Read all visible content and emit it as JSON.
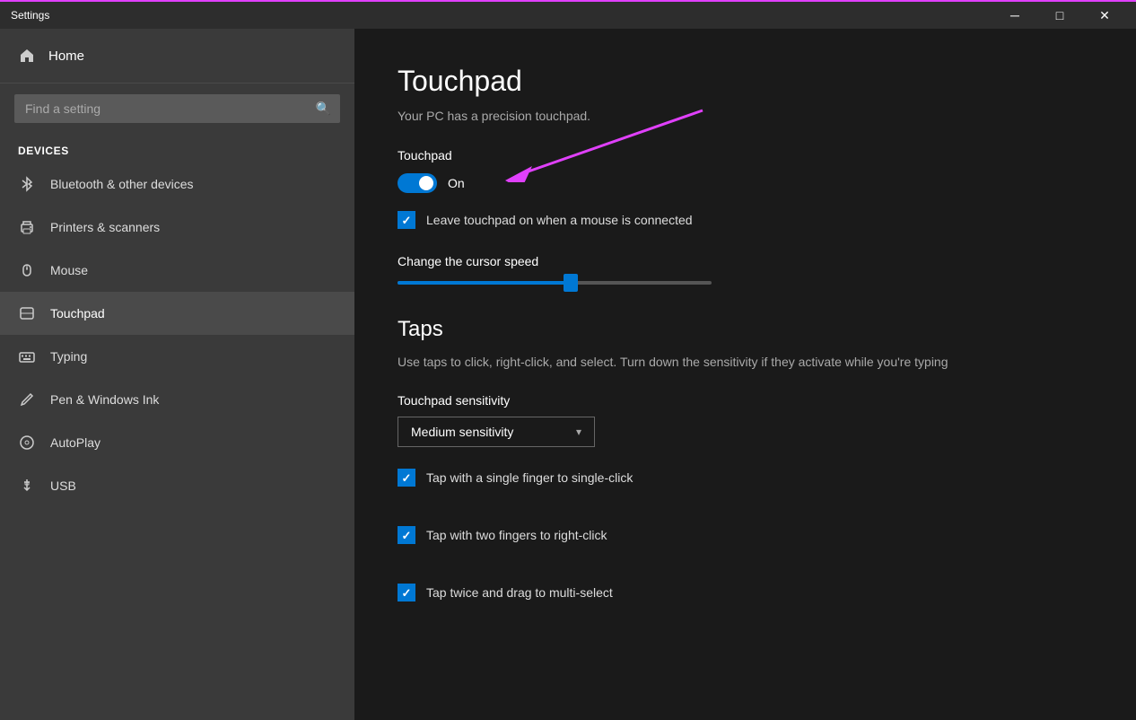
{
  "titlebar": {
    "title": "Settings",
    "minimize_label": "─",
    "maximize_label": "□",
    "close_label": "✕"
  },
  "sidebar": {
    "home_label": "Home",
    "search_placeholder": "Find a setting",
    "section_title": "Devices",
    "nav_items": [
      {
        "id": "bluetooth",
        "label": "Bluetooth & other devices",
        "icon": "bluetooth"
      },
      {
        "id": "printers",
        "label": "Printers & scanners",
        "icon": "printer"
      },
      {
        "id": "mouse",
        "label": "Mouse",
        "icon": "mouse"
      },
      {
        "id": "touchpad",
        "label": "Touchpad",
        "icon": "touchpad",
        "active": true
      },
      {
        "id": "typing",
        "label": "Typing",
        "icon": "keyboard"
      },
      {
        "id": "pen",
        "label": "Pen & Windows Ink",
        "icon": "pen"
      },
      {
        "id": "autoplay",
        "label": "AutoPlay",
        "icon": "autoplay"
      },
      {
        "id": "usb",
        "label": "USB",
        "icon": "usb"
      }
    ]
  },
  "content": {
    "page_title": "Touchpad",
    "subtitle": "Your PC has a precision touchpad.",
    "touchpad_section_label": "Touchpad",
    "toggle_on_label": "On",
    "checkbox_label": "Leave touchpad on when a mouse is connected",
    "slider_title": "Change the cursor speed",
    "taps_title": "Taps",
    "taps_desc": "Use taps to click, right-click, and select. Turn down the sensitivity if they activate while you're typing",
    "sensitivity_label": "Touchpad sensitivity",
    "sensitivity_value": "Medium sensitivity",
    "single_tap_label": "Tap with a single finger to single-click",
    "two_finger_label": "Tap with two fingers to right-click",
    "double_tap_label": "Tap twice and drag to multi-select"
  }
}
